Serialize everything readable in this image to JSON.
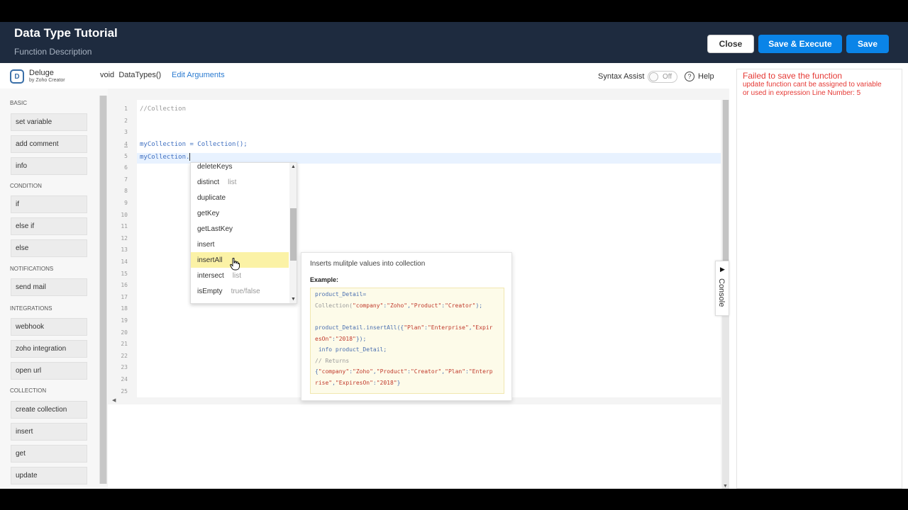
{
  "header": {
    "title": "Data Type Tutorial",
    "subtitle": "Function Description",
    "close_label": "Close",
    "save_execute_label": "Save & Execute",
    "save_label": "Save"
  },
  "toolbar": {
    "logo_name": "Deluge",
    "logo_by": "by Zoho Creator",
    "fn_return": "void",
    "fn_name": "DataTypes()",
    "edit_args_label": "Edit Arguments",
    "syntax_assist_label": "Syntax Assist",
    "syntax_assist_state": "Off",
    "help_label": "Help"
  },
  "sidebar": {
    "sections": [
      {
        "title": "BASIC",
        "items": [
          "set variable",
          "add comment",
          "info"
        ]
      },
      {
        "title": "CONDITION",
        "items": [
          "if",
          "else if",
          "else"
        ]
      },
      {
        "title": "NOTIFICATIONS",
        "items": [
          "send mail"
        ]
      },
      {
        "title": "INTEGRATIONS",
        "items": [
          "webhook",
          "zoho integration",
          "open url"
        ]
      },
      {
        "title": "COLLECTION",
        "items": [
          "create collection",
          "insert",
          "get",
          "update"
        ]
      }
    ]
  },
  "editor": {
    "line_numbers": [
      "1",
      "2",
      "3",
      "4",
      "5",
      "6",
      "7",
      "8",
      "9",
      "10",
      "11",
      "12",
      "13",
      "14",
      "15",
      "16",
      "17",
      "18",
      "19",
      "20",
      "21",
      "22",
      "23",
      "24",
      "25"
    ],
    "lines": {
      "l1": "//Collection",
      "l4": "myCollection = Collection();",
      "l5": "myCollection."
    }
  },
  "autocomplete": {
    "items": [
      {
        "name": "deleteKeys",
        "hint": ""
      },
      {
        "name": "distinct",
        "hint": "list"
      },
      {
        "name": "duplicate",
        "hint": ""
      },
      {
        "name": "getKey",
        "hint": ""
      },
      {
        "name": "getLastKey",
        "hint": ""
      },
      {
        "name": "insert",
        "hint": ""
      },
      {
        "name": "insertAll",
        "hint": ""
      },
      {
        "name": "intersect",
        "hint": "list"
      },
      {
        "name": "isEmpty",
        "hint": "true/false"
      }
    ],
    "selected": "insertAll"
  },
  "doc": {
    "description": "Inserts mulitple values into collection",
    "example_label": "Example:",
    "code": {
      "l1a": "product_Detail=",
      "l2a": "Collection(",
      "l2b": "\"company\"",
      "l2c": ":",
      "l2d": "\"Zoho\"",
      "l2e": ",",
      "l2f": "\"Product\"",
      "l2g": ":",
      "l2h": "\"Creator\"",
      "l2i": ");",
      "l3a": "product_Detail.insertAll({",
      "l3b": "\"Plan\"",
      "l3c": ":",
      "l3d": "\"Enterprise\"",
      "l3e": ",",
      "l3f": "\"Expir",
      "l4a": "esOn\"",
      "l4b": ":",
      "l4c": "\"2018\"",
      "l4d": "});",
      "l5a": " info product_Detail;",
      "l6a": "// Returns",
      "l7a": "{",
      "l7b": "\"company\"",
      "l7c": ":",
      "l7d": "\"Zoho\"",
      "l7e": ",",
      "l7f": "\"Product\"",
      "l7g": ":",
      "l7h": "\"Creator\"",
      "l7i": ",",
      "l7j": "\"Plan\"",
      "l7k": ":",
      "l7l": "\"Enterp",
      "l8a": "rise\"",
      "l8b": ",",
      "l8c": "\"ExpiresOn\"",
      "l8d": ":",
      "l8e": "\"2018\"",
      "l8f": "}"
    }
  },
  "console": {
    "label": "Console"
  },
  "error": {
    "title": "Failed to save the function",
    "message": "update function cant be assigned to variable or used in expression Line Number: 5"
  }
}
